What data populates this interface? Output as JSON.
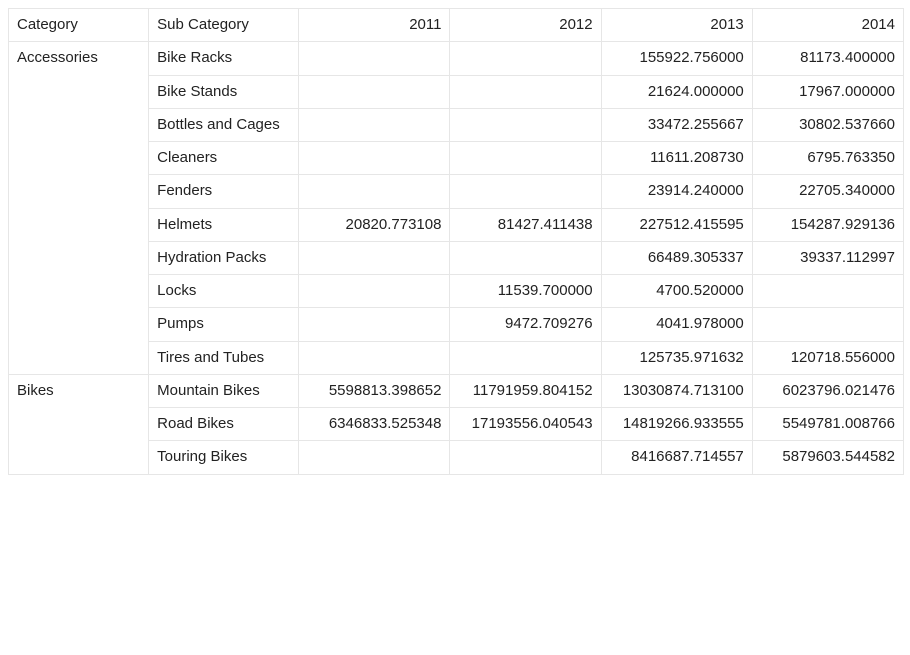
{
  "headers": {
    "category": "Category",
    "subCategory": "Sub Category",
    "y2011": "2011",
    "y2012": "2012",
    "y2013": "2013",
    "y2014": "2014"
  },
  "groups": [
    {
      "category": "Accessories",
      "rows": [
        {
          "sub": "Bike Racks",
          "y2011": "",
          "y2012": "",
          "y2013": "155922.756000",
          "y2014": "81173.400000"
        },
        {
          "sub": "Bike Stands",
          "y2011": "",
          "y2012": "",
          "y2013": "21624.000000",
          "y2014": "17967.000000"
        },
        {
          "sub": "Bottles and Cages",
          "y2011": "",
          "y2012": "",
          "y2013": "33472.255667",
          "y2014": "30802.537660"
        },
        {
          "sub": "Cleaners",
          "y2011": "",
          "y2012": "",
          "y2013": "11611.208730",
          "y2014": "6795.763350"
        },
        {
          "sub": "Fenders",
          "y2011": "",
          "y2012": "",
          "y2013": "23914.240000",
          "y2014": "22705.340000"
        },
        {
          "sub": "Helmets",
          "y2011": "20820.773108",
          "y2012": "81427.411438",
          "y2013": "227512.415595",
          "y2014": "154287.929136"
        },
        {
          "sub": "Hydration Packs",
          "y2011": "",
          "y2012": "",
          "y2013": "66489.305337",
          "y2014": "39337.112997"
        },
        {
          "sub": "Locks",
          "y2011": "",
          "y2012": "11539.700000",
          "y2013": "4700.520000",
          "y2014": ""
        },
        {
          "sub": "Pumps",
          "y2011": "",
          "y2012": "9472.709276",
          "y2013": "4041.978000",
          "y2014": ""
        },
        {
          "sub": "Tires and Tubes",
          "y2011": "",
          "y2012": "",
          "y2013": "125735.971632",
          "y2014": "120718.556000"
        }
      ]
    },
    {
      "category": "Bikes",
      "rows": [
        {
          "sub": "Mountain Bikes",
          "y2011": "5598813.398652",
          "y2012": "11791959.804152",
          "y2013": "13030874.713100",
          "y2014": "6023796.021476"
        },
        {
          "sub": "Road Bikes",
          "y2011": "6346833.525348",
          "y2012": "17193556.040543",
          "y2013": "14819266.933555",
          "y2014": "5549781.008766"
        },
        {
          "sub": "Touring Bikes",
          "y2011": "",
          "y2012": "",
          "y2013": "8416687.714557",
          "y2014": "5879603.544582"
        }
      ]
    }
  ],
  "chart_data": {
    "type": "table",
    "title": "",
    "columns": [
      "Category",
      "Sub Category",
      "2011",
      "2012",
      "2013",
      "2014"
    ],
    "rows": [
      [
        "Accessories",
        "Bike Racks",
        null,
        null,
        155922.756,
        81173.4
      ],
      [
        "Accessories",
        "Bike Stands",
        null,
        null,
        21624.0,
        17967.0
      ],
      [
        "Accessories",
        "Bottles and Cages",
        null,
        null,
        33472.255667,
        30802.53766
      ],
      [
        "Accessories",
        "Cleaners",
        null,
        null,
        11611.20873,
        6795.76335
      ],
      [
        "Accessories",
        "Fenders",
        null,
        null,
        23914.24,
        22705.34
      ],
      [
        "Accessories",
        "Helmets",
        20820.773108,
        81427.411438,
        227512.415595,
        154287.929136
      ],
      [
        "Accessories",
        "Hydration Packs",
        null,
        null,
        66489.305337,
        39337.112997
      ],
      [
        "Accessories",
        "Locks",
        null,
        11539.7,
        4700.52,
        null
      ],
      [
        "Accessories",
        "Pumps",
        null,
        9472.709276,
        4041.978,
        null
      ],
      [
        "Accessories",
        "Tires and Tubes",
        null,
        null,
        125735.971632,
        120718.556
      ],
      [
        "Bikes",
        "Mountain Bikes",
        5598813.398652,
        11791959.804152,
        13030874.7131,
        6023796.021476
      ],
      [
        "Bikes",
        "Road Bikes",
        6346833.525348,
        17193556.040543,
        14819266.933555,
        5549781.008766
      ],
      [
        "Bikes",
        "Touring Bikes",
        null,
        null,
        8416687.714557,
        5879603.544582
      ]
    ]
  }
}
